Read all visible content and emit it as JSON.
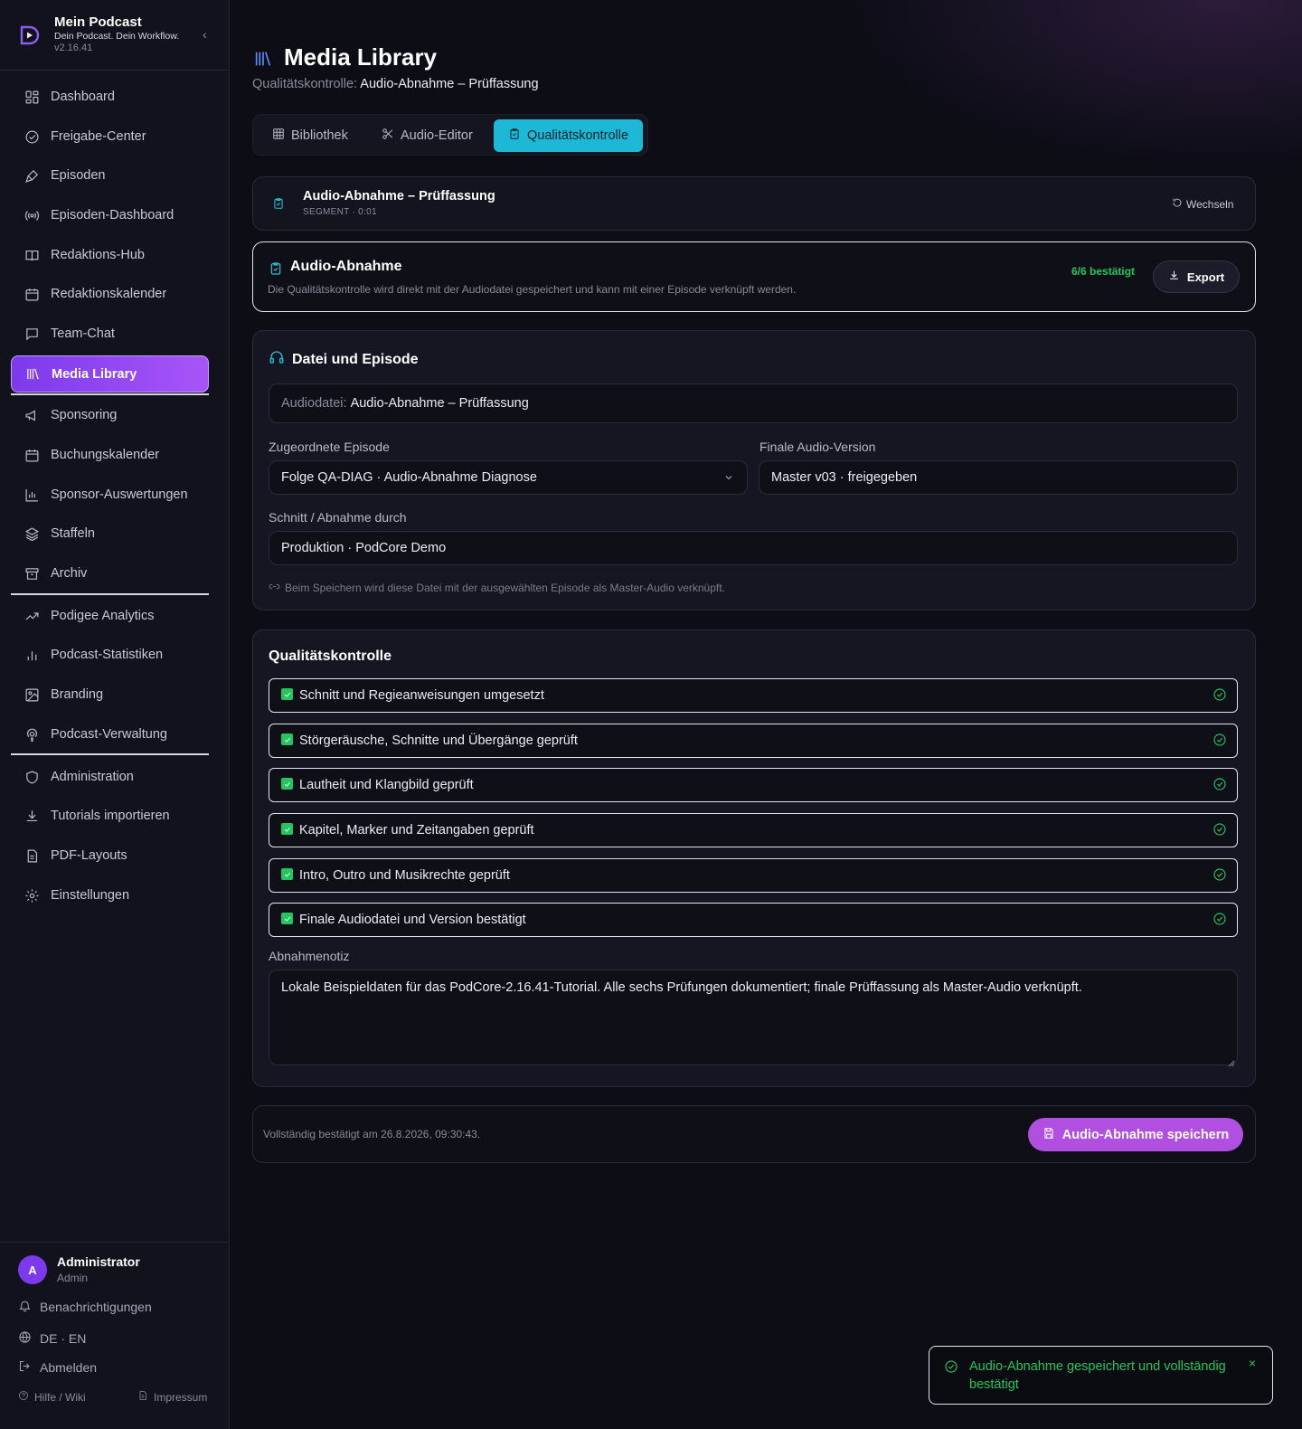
{
  "brand": {
    "title": "Mein Podcast",
    "subtitle": "Dein Podcast. Dein Workflow.",
    "version": "v2.16.41"
  },
  "nav": [
    {
      "label": "Dashboard",
      "icon": "grid-icon"
    },
    {
      "label": "Freigabe-Center",
      "icon": "check-circle-icon"
    },
    {
      "label": "Episoden",
      "icon": "microphone-icon"
    },
    {
      "label": "Episoden-Dashboard",
      "icon": "radio-icon"
    },
    {
      "label": "Redaktions-Hub",
      "icon": "book-icon"
    },
    {
      "label": "Redaktionskalender",
      "icon": "calendar-icon"
    },
    {
      "label": "Team-Chat",
      "icon": "chat-icon"
    },
    {
      "label": "Media Library",
      "icon": "library-icon",
      "active": true
    },
    {
      "label": "Sponsoring",
      "icon": "megaphone-icon"
    },
    {
      "label": "Buchungskalender",
      "icon": "calendar-icon"
    },
    {
      "label": "Sponsor-Auswertungen",
      "icon": "bar-chart-icon"
    },
    {
      "label": "Staffeln",
      "icon": "layers-icon"
    },
    {
      "label": "Archiv",
      "icon": "archive-icon"
    },
    {
      "label": "Podigee Analytics",
      "icon": "trend-icon"
    },
    {
      "label": "Podcast-Statistiken",
      "icon": "bar-chart-icon"
    },
    {
      "label": "Branding",
      "icon": "image-icon"
    },
    {
      "label": "Podcast-Verwaltung",
      "icon": "podcast-icon"
    },
    {
      "label": "Administration",
      "icon": "shield-icon"
    },
    {
      "label": "Tutorials importieren",
      "icon": "download-icon"
    },
    {
      "label": "PDF-Layouts",
      "icon": "file-icon"
    },
    {
      "label": "Einstellungen",
      "icon": "gear-icon"
    }
  ],
  "user": {
    "initial": "A",
    "name": "Administrator",
    "role": "Admin"
  },
  "sidebar_footer": {
    "notifications": "Benachrichtigungen",
    "language": "DE · EN",
    "logout": "Abmelden",
    "help": "Hilfe / Wiki",
    "imprint": "Impressum"
  },
  "page": {
    "title": "Media Library",
    "sub_label": "Qualitätskontrolle:",
    "sub_value": "Audio-Abnahme – Prüffassung"
  },
  "tabs": [
    {
      "label": "Bibliothek",
      "icon": "table-icon"
    },
    {
      "label": "Audio-Editor",
      "icon": "scissors-icon"
    },
    {
      "label": "Qualitätskontrolle",
      "icon": "clipboard-check-icon",
      "active": true
    }
  ],
  "segment": {
    "title": "Audio-Abnahme – Prüffassung",
    "meta": "SEGMENT · 0:01",
    "switch": "Wechseln"
  },
  "abnahme": {
    "title": "Audio-Abnahme",
    "desc": "Die Qualitätskontrolle wird direkt mit der Audiodatei gespeichert und kann mit einer Episode verknüpft werden.",
    "count": "6/6 bestätigt",
    "export": "Export"
  },
  "file": {
    "title": "Datei und Episode",
    "audio_label": "Audiodatei:",
    "audio_value": "Audio-Abnahme – Prüffassung",
    "episode_label": "Zugeordnete Episode",
    "episode_value": "Folge QA-DIAG · Audio-Abnahme Diagnose",
    "version_label": "Finale Audio-Version",
    "version_value": "Master v03 · freigegeben",
    "by_label": "Schnitt / Abnahme durch",
    "by_value": "Produktion · PodCore Demo",
    "hint": "Beim Speichern wird diese Datei mit der ausgewählten Episode als Master-Audio verknüpft."
  },
  "qk": {
    "title": "Qualitätskontrolle",
    "items": [
      {
        "label": "Schnitt und Regieanweisungen umgesetzt",
        "checked": true
      },
      {
        "label": "Störgeräusche, Schnitte und Übergänge geprüft",
        "checked": true
      },
      {
        "label": "Lautheit und Klangbild geprüft",
        "checked": true
      },
      {
        "label": "Kapitel, Marker und Zeitangaben geprüft",
        "checked": true
      },
      {
        "label": "Intro, Outro und Musikrechte geprüft",
        "checked": true
      },
      {
        "label": "Finale Audiodatei und Version bestätigt",
        "checked": true
      }
    ],
    "note_label": "Abnahmenotiz",
    "note_value": "Lokale Beispieldaten für das PodCore-2.16.41-Tutorial. Alle sechs Prüfungen dokumentiert; finale Prüffassung als Master-Audio verknüpft."
  },
  "save": {
    "status": "Vollständig bestätigt am 26.8.2026, 09:30:43.",
    "button": "Audio-Abnahme speichern"
  },
  "toast": {
    "text": "Audio-Abnahme gespeichert und vollständig bestätigt",
    "close": "×"
  },
  "colors": {
    "accent": "#a855f7",
    "cyan": "#1cb8d6",
    "success": "#22c55e",
    "background": "#0d0d16"
  }
}
